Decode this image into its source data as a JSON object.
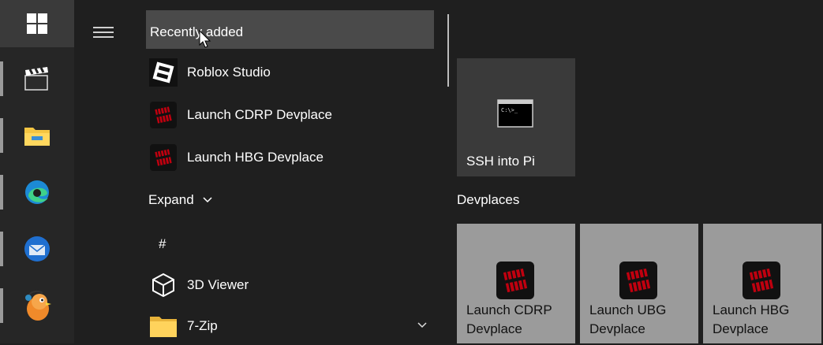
{
  "taskbar": {
    "start_icon": "windows-logo-icon",
    "pinned": [
      "clapperboard-app-icon",
      "file-explorer-icon",
      "edge-browser-icon",
      "thunderbird-icon",
      "bird-app-icon"
    ]
  },
  "menu": {
    "section_header": "Recently added",
    "recent": [
      {
        "label": "Roblox Studio",
        "icon": "roblox-studio-icon"
      },
      {
        "label": "Launch CDRP Devplace",
        "icon": "devplace-icon"
      },
      {
        "label": "Launch HBG Devplace",
        "icon": "devplace-icon"
      }
    ],
    "expand_label": "Expand",
    "letter_header": "#",
    "apps": [
      {
        "label": "3D Viewer",
        "icon": "cube-icon"
      },
      {
        "label": "7-Zip",
        "icon": "folder-icon"
      }
    ]
  },
  "tiles": {
    "ssh": {
      "label": "SSH into Pi",
      "icon": "terminal-icon"
    },
    "group_title": "Devplaces",
    "devplaces": [
      {
        "line1": "Launch CDRP",
        "line2": "Devplace"
      },
      {
        "line1": "Launch UBG",
        "line2": "Devplace"
      },
      {
        "line1": "Launch HBG",
        "line2": "Devplace"
      }
    ]
  },
  "colors": {
    "tile_gray": "#9b9b9b",
    "accent_red": "#c0000f"
  }
}
